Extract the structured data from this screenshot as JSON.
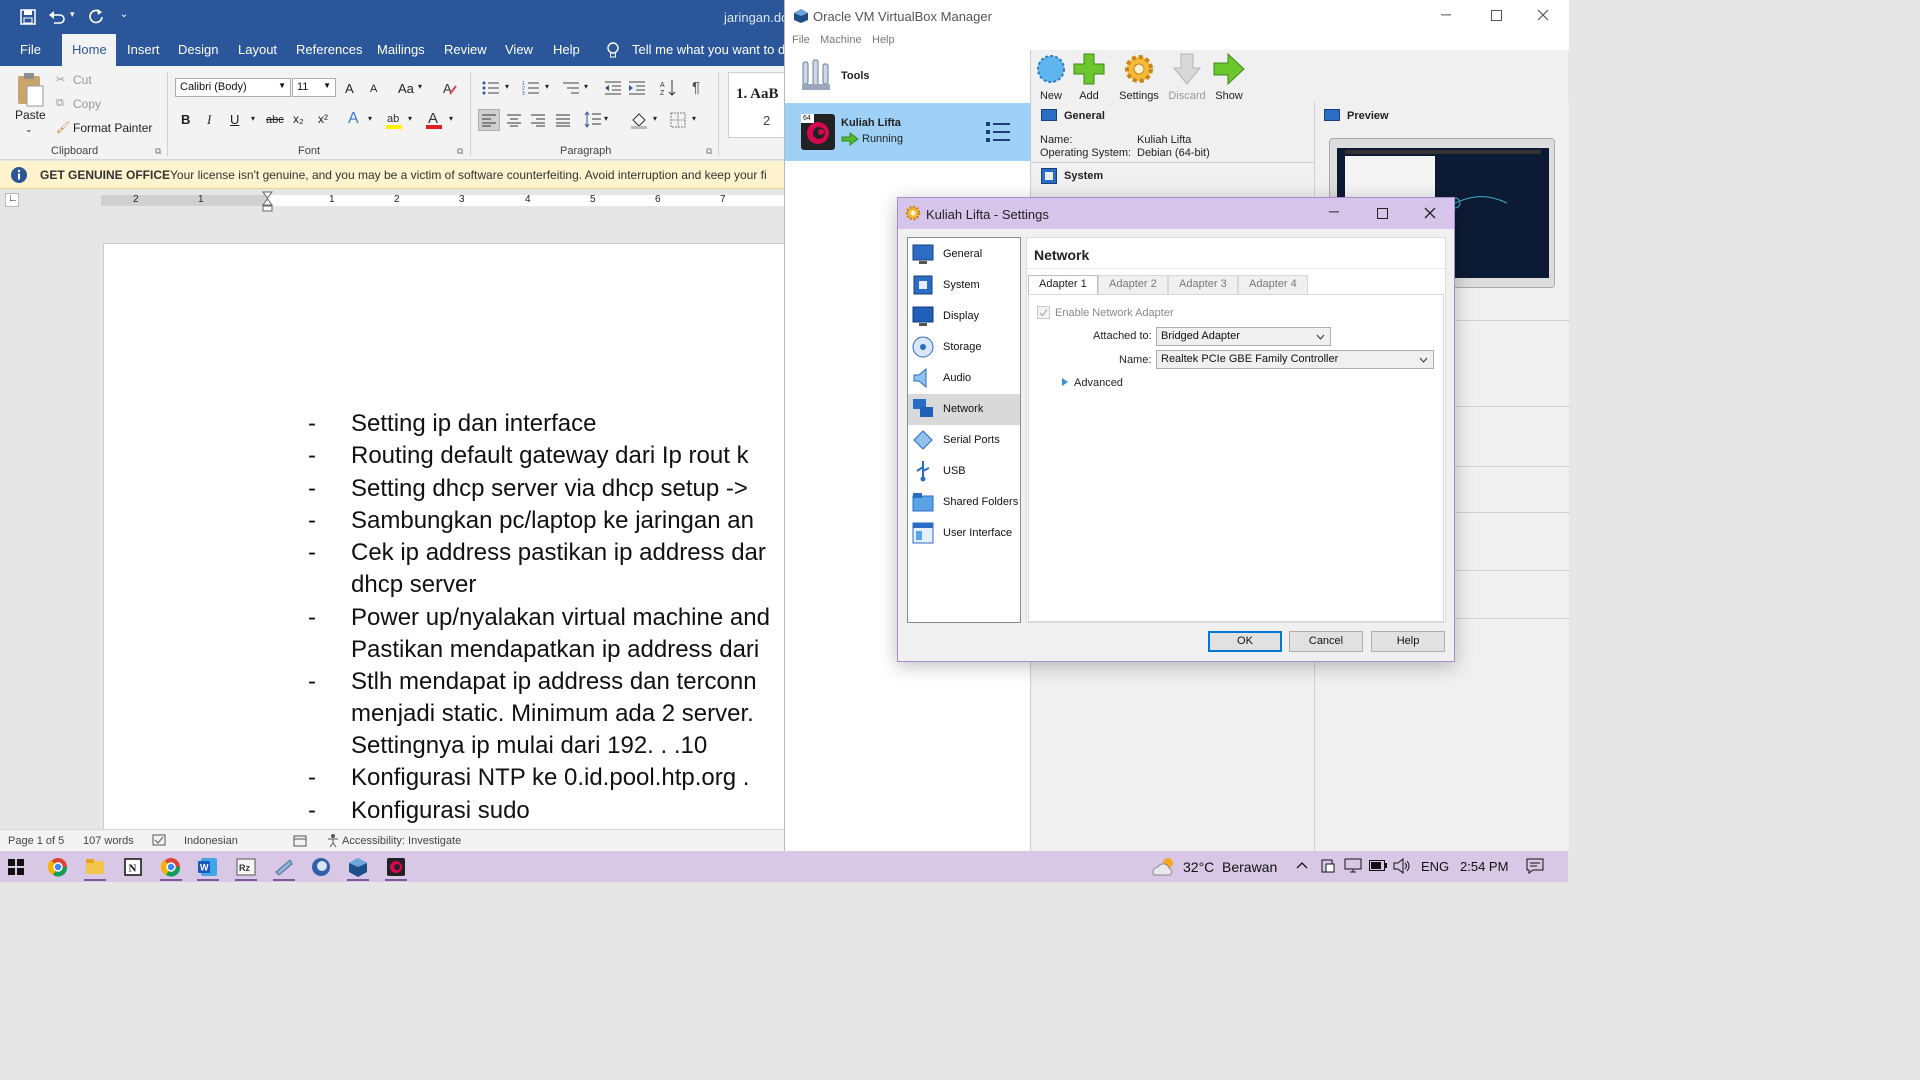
{
  "word": {
    "title": "jaringan.do",
    "tabs": [
      "File",
      "Home",
      "Insert",
      "Design",
      "Layout",
      "References",
      "Mailings",
      "Review",
      "View",
      "Help"
    ],
    "tell_me": "Tell me what you want to do",
    "clipboard": {
      "paste": "Paste",
      "cut": "Cut",
      "copy": "Copy",
      "format_painter": "Format Painter",
      "label": "Clipboard"
    },
    "font": {
      "name": "Calibri (Body)",
      "size": "11",
      "label": "Font",
      "bold": "B",
      "italic": "I",
      "underline": "U",
      "strike": "abc",
      "sub": "x₂",
      "sup": "x²",
      "grow": "A",
      "shrink": "A",
      "case": "Aa"
    },
    "paragraph": {
      "label": "Paragraph",
      "pilcrow": "¶"
    },
    "styles": {
      "preview": "1. AaB",
      "num": "2"
    },
    "warning": {
      "title": "GET GENUINE OFFICE",
      "text": "Your license isn't genuine, and you may be a victim of software counterfeiting. Avoid interruption and keep your fi"
    },
    "ruler_left": [
      "2",
      "1"
    ],
    "ruler_right": [
      "1",
      "2",
      "3",
      "4",
      "5",
      "6",
      "7"
    ],
    "bullet_char": "-",
    "lines": [
      {
        "bullet": true,
        "text": "Setting ip dan interface"
      },
      {
        "bullet": true,
        "text": "Routing default gateway dari Ip rout k"
      },
      {
        "bullet": true,
        "text": "Setting dhcp server via dhcp setup ->"
      },
      {
        "bullet": true,
        "text": "Sambungkan pc/laptop ke jaringan an"
      },
      {
        "bullet": true,
        "text": "Cek ip address pastikan ip address dar"
      },
      {
        "bullet": false,
        "text": "dhcp server"
      },
      {
        "bullet": true,
        "text": "Power up/nyalakan virtual machine and"
      },
      {
        "bullet": false,
        "text": "Pastikan mendapatkan ip address dari"
      },
      {
        "bullet": true,
        "text": "Stlh mendapat ip address dan terconn"
      },
      {
        "bullet": false,
        "text": "menjadi static. Minimum ada 2 server."
      },
      {
        "bullet": false,
        "text": "Settingnya ip mulai dari 192. . .10"
      },
      {
        "bullet": true,
        "text": "Konfigurasi NTP ke 0.id.pool.htp.org ."
      },
      {
        "bullet": true,
        "text": "Konfigurasi sudo"
      }
    ],
    "status": {
      "page": "Page 1 of 5",
      "words": "107 words",
      "lang": "Indonesian",
      "access": "Accessibility: Investigate"
    }
  },
  "vbox": {
    "title": "Oracle VM VirtualBox Manager",
    "menu": [
      "File",
      "Machine",
      "Help"
    ],
    "tools_label": "Tools",
    "toolbar": [
      "New",
      "Add",
      "Settings",
      "Discard",
      "Show"
    ],
    "vm": {
      "name": "Kuliah Lifta",
      "state": "Running",
      "badge": "64"
    },
    "general": {
      "header": "General",
      "name_label": "Name:",
      "name_value": "Kuliah Lifta",
      "os_label": "Operating System:",
      "os_value": "Debian (64-bit)"
    },
    "system_header": "System",
    "preview_header": "Preview"
  },
  "dialog": {
    "title": "Kuliah Lifta - Settings",
    "sections": [
      "General",
      "System",
      "Display",
      "Storage",
      "Audio",
      "Network",
      "Serial Ports",
      "USB",
      "Shared Folders",
      "User Interface"
    ],
    "selected_section": "Network",
    "panel_title": "Network",
    "adapter_tabs": [
      "Adapter 1",
      "Adapter 2",
      "Adapter 3",
      "Adapter 4"
    ],
    "enable_label": "Enable Network Adapter",
    "attached_label": "Attached to:",
    "attached_value": "Bridged Adapter",
    "name_label": "Name:",
    "name_value": "Realtek PCIe GBE Family Controller",
    "advanced_label": "Advanced",
    "buttons": {
      "ok": "OK",
      "cancel": "Cancel",
      "help": "Help"
    }
  },
  "taskbar": {
    "weather_temp": "32°C",
    "weather_text": "Berawan",
    "lang": "ENG",
    "time": "2:54 PM"
  }
}
